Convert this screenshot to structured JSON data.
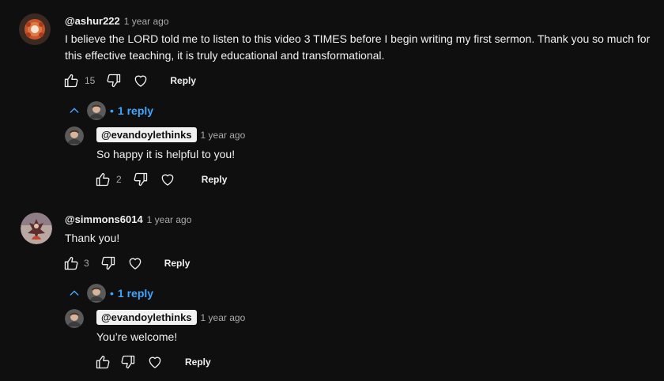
{
  "comments": [
    {
      "handle": "@ashur222",
      "time": "1 year ago",
      "text": "I believe the LORD told me to listen to this video 3 TIMES before I begin writing my first sermon. Thank you so much for this effective teaching, it is truly educational and transformational.",
      "likes": "15",
      "reply_label": "Reply",
      "replies_toggle": "1 reply",
      "reply": {
        "handle": "@evandoylethinks",
        "time": "1 year ago",
        "text": "So happy it is helpful to you!",
        "likes": "2",
        "reply_label": "Reply"
      }
    },
    {
      "handle": "@simmons6014",
      "time": "1 year ago",
      "text": "Thank you!",
      "likes": "3",
      "reply_label": "Reply",
      "replies_toggle": "1 reply",
      "reply": {
        "handle": "@evandoylethinks",
        "time": "1 year ago",
        "text": "You’re welcome!",
        "likes": "",
        "reply_label": "Reply"
      }
    }
  ],
  "icons": {
    "like": "thumbs-up-icon",
    "dislike": "thumbs-down-icon",
    "heart": "heart-icon",
    "collapse": "chevron-up-icon",
    "dot": "•"
  },
  "colors": {
    "background": "#0f0f0f",
    "text": "#f1f1f1",
    "muted": "#aaaaaa",
    "link": "#3ea6ff"
  }
}
